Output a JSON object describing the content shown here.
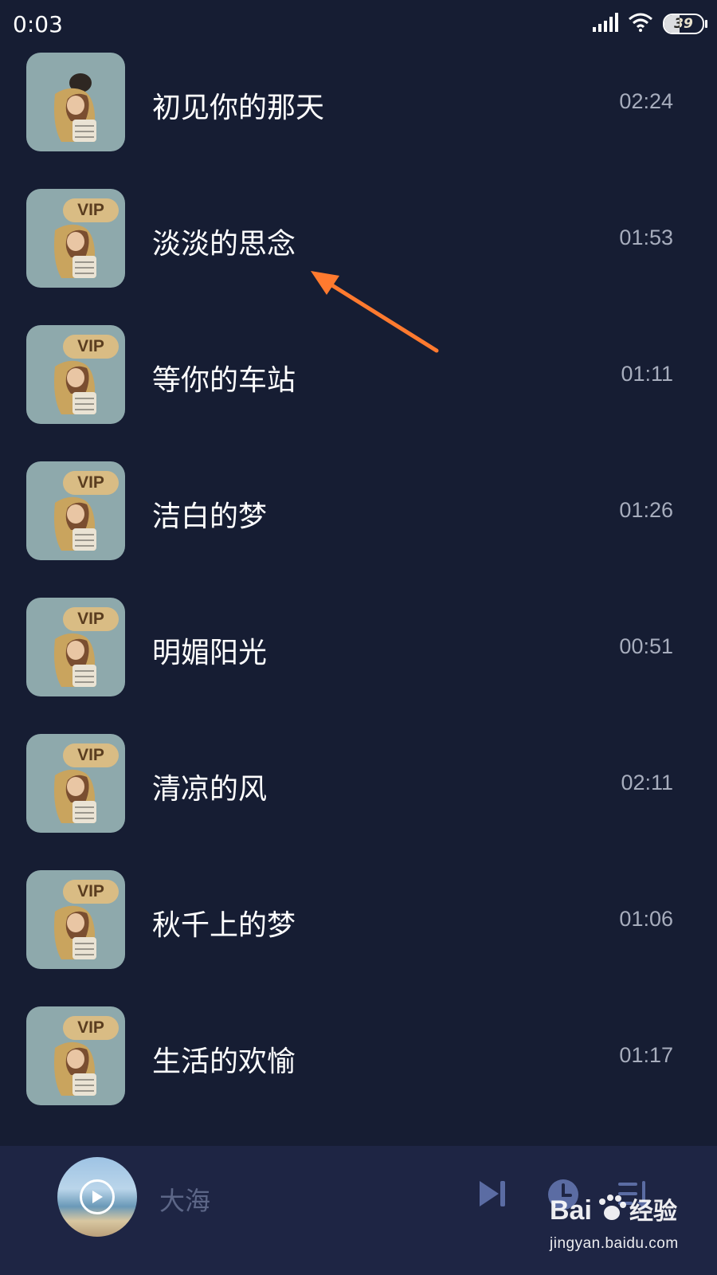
{
  "status_bar": {
    "time": "0:03",
    "battery_level": "39",
    "icons": [
      "signal-icon",
      "wifi-icon",
      "battery-icon"
    ]
  },
  "songs": [
    {
      "title": "初见你的那天",
      "duration": "02:24",
      "vip": false
    },
    {
      "title": "淡淡的思念",
      "duration": "01:53",
      "vip": true,
      "vip_label": "VIP"
    },
    {
      "title": "等你的车站",
      "duration": "01:11",
      "vip": true,
      "vip_label": "VIP"
    },
    {
      "title": "洁白的梦",
      "duration": "01:26",
      "vip": true,
      "vip_label": "VIP"
    },
    {
      "title": "明媚阳光",
      "duration": "00:51",
      "vip": true,
      "vip_label": "VIP"
    },
    {
      "title": "清凉的风",
      "duration": "02:11",
      "vip": true,
      "vip_label": "VIP"
    },
    {
      "title": "秋千上的梦",
      "duration": "01:06",
      "vip": true,
      "vip_label": "VIP"
    },
    {
      "title": "生活的欢愉",
      "duration": "01:17",
      "vip": true,
      "vip_label": "VIP"
    }
  ],
  "annotation": {
    "color": "#ff7a2f",
    "points_to": "淡淡的思念"
  },
  "player": {
    "now_playing_title": "大海",
    "icons": [
      "play-icon",
      "next-track-icon",
      "timer-icon",
      "playlist-icon"
    ]
  },
  "watermark": {
    "logo_text": "Bai经验",
    "url": "jingyan.baidu.com"
  },
  "colors": {
    "background": "#161d33",
    "player_bar": "#1e2544",
    "cover_bg": "#8ea9ac",
    "vip_badge": "#d9bc84",
    "duration_text": "#a7adbd",
    "control_icons": "#5b6ca3"
  }
}
